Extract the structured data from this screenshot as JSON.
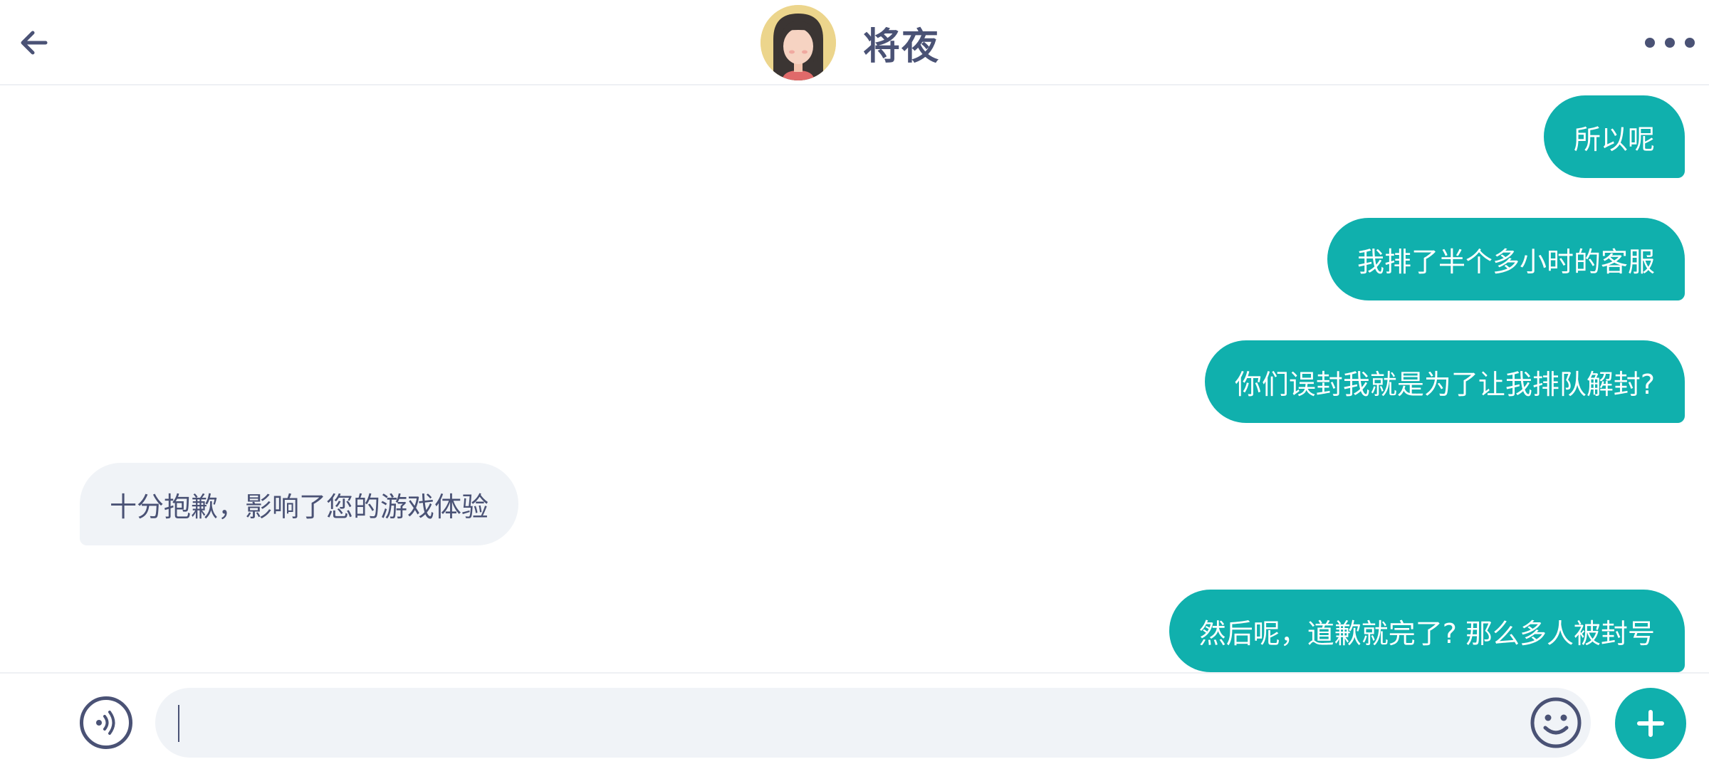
{
  "header": {
    "contact_name": "将夜"
  },
  "messages": [
    {
      "from": "me",
      "text": "所以呢"
    },
    {
      "from": "me",
      "text": "我排了半个多小时的客服"
    },
    {
      "from": "me",
      "text": "你们误封我就是为了让我排队解封?"
    },
    {
      "from": "them",
      "text": "十分抱歉，影响了您的游戏体验"
    },
    {
      "from": "me",
      "text": "然后呢，道歉就完了? 那么多人被封号"
    }
  ],
  "input": {
    "value": ""
  },
  "icons": {
    "back": "arrow-left-icon",
    "more": "more-horizontal-icon",
    "voice": "voice-icon",
    "emoji": "emoji-smile-icon",
    "plus": "plus-icon"
  },
  "colors": {
    "accent": "#10b0ad",
    "text": "#4a5275",
    "incoming_bubble": "#f0f3f7",
    "avatar_bg": "#ecd58c"
  }
}
